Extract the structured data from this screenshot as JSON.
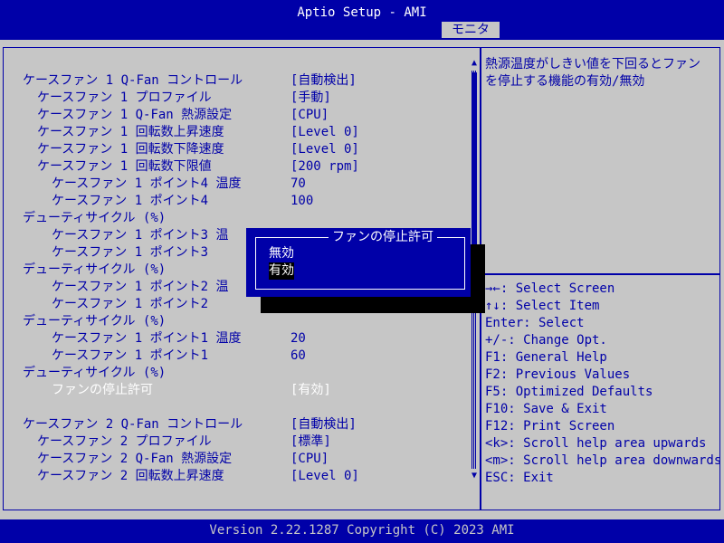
{
  "window": {
    "title": "Aptio Setup - AMI",
    "active_tab": "モニタ"
  },
  "settings": [
    {
      "label": "ケースファン 1 Q-Fan コントロール",
      "value": "[自動検出]",
      "indent": 0
    },
    {
      "label": "ケースファン 1 プロファイル",
      "value": "[手動]",
      "indent": 1
    },
    {
      "label": "ケースファン 1 Q-Fan 熱源設定",
      "value": "[CPU]",
      "indent": 1
    },
    {
      "label": "ケースファン 1 回転数上昇速度",
      "value": "[Level 0]",
      "indent": 1
    },
    {
      "label": "ケースファン 1 回転数下降速度",
      "value": "[Level 0]",
      "indent": 1
    },
    {
      "label": "ケースファン 1 回転数下限値",
      "value": "[200 rpm]",
      "indent": 1
    },
    {
      "label": "ケースファン 1 ポイント4 温度",
      "value": "70",
      "indent": 2
    },
    {
      "label": "ケースファン 1 ポイント4",
      "value": "100",
      "indent": 2
    },
    {
      "label": "デューティサイクル (%)",
      "value": "",
      "indent": 0
    },
    {
      "label": "ケースファン 1 ポイント3 温",
      "value": "",
      "indent": 2
    },
    {
      "label": "ケースファン 1 ポイント3",
      "value": "",
      "indent": 2
    },
    {
      "label": "デューティサイクル (%)",
      "value": "",
      "indent": 0
    },
    {
      "label": "ケースファン 1 ポイント2 温",
      "value": "",
      "indent": 2
    },
    {
      "label": "ケースファン 1 ポイント2",
      "value": "",
      "indent": 2
    },
    {
      "label": "デューティサイクル (%)",
      "value": "",
      "indent": 0
    },
    {
      "label": "ケースファン 1 ポイント1 温度",
      "value": "20",
      "indent": 2
    },
    {
      "label": "ケースファン 1 ポイント1",
      "value": "60",
      "indent": 2
    },
    {
      "label": "デューティサイクル (%)",
      "value": "",
      "indent": 0
    },
    {
      "label": "ファンの停止許可",
      "value": "[有効]",
      "indent": 2,
      "selected": true
    },
    {
      "label": "",
      "value": "",
      "indent": 0
    },
    {
      "label": "ケースファン 2 Q-Fan コントロール",
      "value": "[自動検出]",
      "indent": 0
    },
    {
      "label": "ケースファン 2 プロファイル",
      "value": "[標準]",
      "indent": 1
    },
    {
      "label": "ケースファン 2 Q-Fan 熱源設定",
      "value": "[CPU]",
      "indent": 1
    },
    {
      "label": "ケースファン 2 回転数上昇速度",
      "value": "[Level 0]",
      "indent": 1
    }
  ],
  "help_text": "熱源温度がしきい値を下回るとファンを停止する機能の有効/無効",
  "keys": [
    "→←: Select Screen",
    "↑↓: Select Item",
    "Enter: Select",
    "+/-: Change Opt.",
    "F1: General Help",
    "F2: Previous Values",
    "F5: Optimized Defaults",
    "F10: Save & Exit",
    "F12: Print Screen",
    "<k>: Scroll help area upwards",
    "<m>: Scroll help area downwards",
    "ESC: Exit"
  ],
  "popup": {
    "title": "ファンの停止許可",
    "options": [
      "無効",
      "有効"
    ],
    "highlighted": 1
  },
  "scrollbar": {
    "up": "▲",
    "down": "▼"
  },
  "footer": {
    "version": "Version 2.22.1287 Copyright (C) 2023 AMI"
  },
  "colors": {
    "blue": "#0000a8",
    "gray": "#c6c6c6",
    "white": "#ffffff",
    "shadow": "#000000"
  }
}
